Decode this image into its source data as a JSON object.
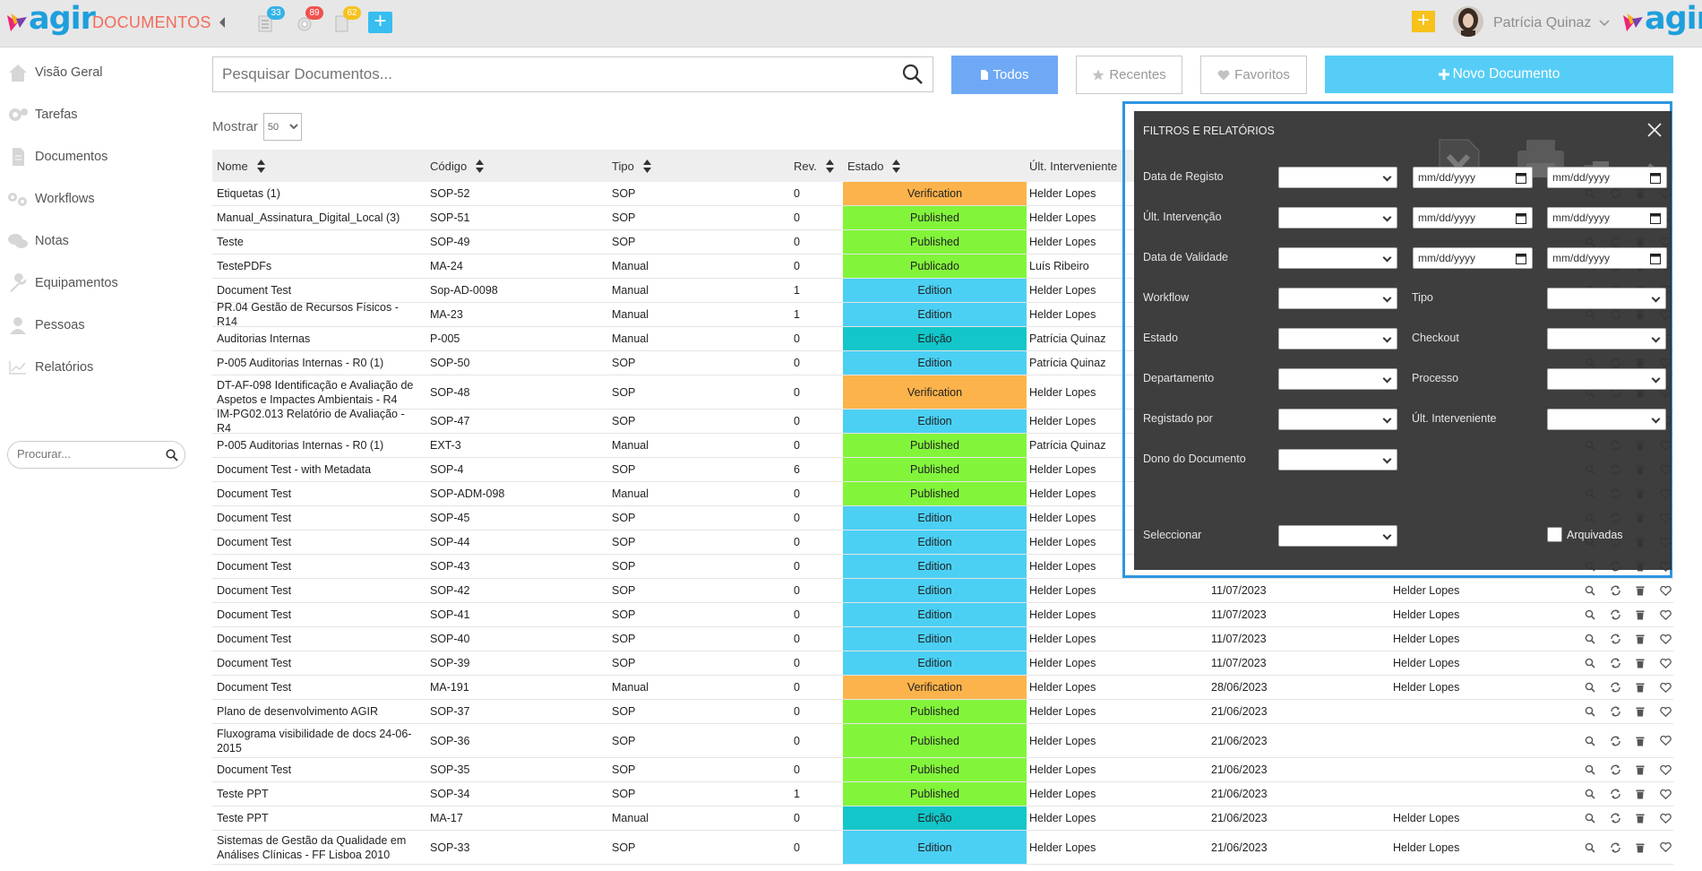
{
  "app": {
    "section_title": "DOCUMENTOS",
    "logo_text": "agir",
    "user_name": "Patrícia Quinaz"
  },
  "badges": {
    "docs": "33",
    "settings": "89",
    "files": "62"
  },
  "colors": {
    "accent": "#56cdf6",
    "verification": "#fcb34b",
    "published": "#82f53b",
    "edition": "#4bd0f4",
    "edicao": "#13c6c9",
    "publicado": "#82f53b"
  },
  "sidebar": {
    "items": [
      {
        "label": "Visão Geral",
        "icon": "home-icon"
      },
      {
        "label": "Tarefas",
        "icon": "gears-icon"
      },
      {
        "label": "Documentos",
        "icon": "document-icon"
      },
      {
        "label": "Workflows",
        "icon": "workflow-icon"
      },
      {
        "label": "Notas",
        "icon": "comments-icon"
      },
      {
        "label": "Equipamentos",
        "icon": "wrench-icon"
      },
      {
        "label": "Pessoas",
        "icon": "user-icon"
      },
      {
        "label": "Relatórios",
        "icon": "chart-icon"
      }
    ],
    "search_placeholder": "Procurar..."
  },
  "search": {
    "placeholder": "Pesquisar Documentos..."
  },
  "toolbar": {
    "all": "Todos",
    "recent": "Recentes",
    "favorites": "Favoritos",
    "new_doc": "Novo Documento"
  },
  "show": {
    "label": "Mostrar",
    "value": "50"
  },
  "columns": {
    "name": "Nome",
    "code": "Código",
    "type": "Tipo",
    "rev": "Rev.",
    "state": "Estado",
    "last": "Últ. Interveniente"
  },
  "rows": [
    {
      "name": "Etiquetas (1)",
      "code": "SOP-52",
      "type": "SOP",
      "rev": "0",
      "state": "Verification",
      "last": "Helder Lopes",
      "date": "",
      "owner": ""
    },
    {
      "name": "Manual_Assinatura_Digital_Local (3)",
      "code": "SOP-51",
      "type": "SOP",
      "rev": "0",
      "state": "Published",
      "last": "Helder Lopes",
      "date": "",
      "owner": ""
    },
    {
      "name": "Teste",
      "code": "SOP-49",
      "type": "SOP",
      "rev": "0",
      "state": "Published",
      "last": "Helder Lopes",
      "date": "",
      "owner": ""
    },
    {
      "name": "TestePDFs",
      "code": "MA-24",
      "type": "Manual",
      "rev": "0",
      "state": "Publicado",
      "last": "Luís Ribeiro",
      "date": "",
      "owner": ""
    },
    {
      "name": "Document Test",
      "code": "Sop-AD-0098",
      "type": "Manual",
      "rev": "1",
      "state": "Edition",
      "last": "Helder Lopes",
      "date": "",
      "owner": ""
    },
    {
      "name": "PR.04 Gestão de Recursos Físicos - R14",
      "code": "MA-23",
      "type": "Manual",
      "rev": "1",
      "state": "Edition",
      "last": "Helder Lopes",
      "date": "",
      "owner": ""
    },
    {
      "name": "Auditorias Internas",
      "code": "P-005",
      "type": "Manual",
      "rev": "0",
      "state": "Edição",
      "last": "Patrícia Quinaz",
      "date": "",
      "owner": ""
    },
    {
      "name": "P-005 Auditorias Internas - R0 (1)",
      "code": "SOP-50",
      "type": "SOP",
      "rev": "0",
      "state": "Edition",
      "last": "Patrícia Quinaz",
      "date": "",
      "owner": ""
    },
    {
      "name": "DT-AF-098 Identificação e Avaliação de Aspetos e Impactes Ambientais - R4",
      "code": "SOP-48",
      "type": "SOP",
      "rev": "0",
      "state": "Verification",
      "last": "Helder Lopes",
      "date": "",
      "owner": ""
    },
    {
      "name": "IM-PG02.013 Relatório de Avaliação - R4",
      "code": "SOP-47",
      "type": "SOP",
      "rev": "0",
      "state": "Edition",
      "last": "Helder Lopes",
      "date": "",
      "owner": ""
    },
    {
      "name": "P-005 Auditorias Internas - R0 (1)",
      "code": "EXT-3",
      "type": "Manual",
      "rev": "0",
      "state": "Published",
      "last": "Patrícia Quinaz",
      "date": "",
      "owner": ""
    },
    {
      "name": "Document Test - with Metadata",
      "code": "SOP-4",
      "type": "SOP",
      "rev": "6",
      "state": "Published",
      "last": "Helder Lopes",
      "date": "",
      "owner": ""
    },
    {
      "name": "Document Test",
      "code": "SOP-ADM-098",
      "type": "Manual",
      "rev": "0",
      "state": "Published",
      "last": "Helder Lopes",
      "date": "",
      "owner": ""
    },
    {
      "name": "Document Test",
      "code": "SOP-45",
      "type": "SOP",
      "rev": "0",
      "state": "Edition",
      "last": "Helder Lopes",
      "date": "",
      "owner": ""
    },
    {
      "name": "Document Test",
      "code": "SOP-44",
      "type": "SOP",
      "rev": "0",
      "state": "Edition",
      "last": "Helder Lopes",
      "date": "",
      "owner": ""
    },
    {
      "name": "Document Test",
      "code": "SOP-43",
      "type": "SOP",
      "rev": "0",
      "state": "Edition",
      "last": "Helder Lopes",
      "date": "",
      "owner": ""
    },
    {
      "name": "Document Test",
      "code": "SOP-42",
      "type": "SOP",
      "rev": "0",
      "state": "Edition",
      "last": "Helder Lopes",
      "date": "11/07/2023",
      "owner": "Helder Lopes"
    },
    {
      "name": "Document Test",
      "code": "SOP-41",
      "type": "SOP",
      "rev": "0",
      "state": "Edition",
      "last": "Helder Lopes",
      "date": "11/07/2023",
      "owner": "Helder Lopes"
    },
    {
      "name": "Document Test",
      "code": "SOP-40",
      "type": "SOP",
      "rev": "0",
      "state": "Edition",
      "last": "Helder Lopes",
      "date": "11/07/2023",
      "owner": "Helder Lopes"
    },
    {
      "name": "Document Test",
      "code": "SOP-39",
      "type": "SOP",
      "rev": "0",
      "state": "Edition",
      "last": "Helder Lopes",
      "date": "11/07/2023",
      "owner": "Helder Lopes"
    },
    {
      "name": "Document Test",
      "code": "MA-191",
      "type": "Manual",
      "rev": "0",
      "state": "Verification",
      "last": "Helder Lopes",
      "date": "28/06/2023",
      "owner": "Helder Lopes"
    },
    {
      "name": "Plano de desenvolvimento AGIR",
      "code": "SOP-37",
      "type": "SOP",
      "rev": "0",
      "state": "Published",
      "last": "Helder Lopes",
      "date": "21/06/2023",
      "owner": ""
    },
    {
      "name": "Fluxograma visibilidade de docs 24-06-2015",
      "code": "SOP-36",
      "type": "SOP",
      "rev": "0",
      "state": "Published",
      "last": "Helder Lopes",
      "date": "21/06/2023",
      "owner": ""
    },
    {
      "name": "Document Test",
      "code": "SOP-35",
      "type": "SOP",
      "rev": "0",
      "state": "Published",
      "last": "Helder Lopes",
      "date": "21/06/2023",
      "owner": ""
    },
    {
      "name": "Teste PPT",
      "code": "SOP-34",
      "type": "SOP",
      "rev": "1",
      "state": "Published",
      "last": "Helder Lopes",
      "date": "21/06/2023",
      "owner": ""
    },
    {
      "name": "Teste PPT",
      "code": "MA-17",
      "type": "Manual",
      "rev": "0",
      "state": "Edição",
      "last": "Helder Lopes",
      "date": "21/06/2023",
      "owner": "Helder Lopes"
    },
    {
      "name": "Sistemas de Gestão da Qualidade em Análises Clínicas - FF Lisboa 2010",
      "code": "SOP-33",
      "type": "SOP",
      "rev": "0",
      "state": "Edition",
      "last": "Helder Lopes",
      "date": "21/06/2023",
      "owner": "Helder Lopes"
    }
  ],
  "filters": {
    "title": "FILTROS E RELATÓRIOS",
    "date_placeholder": "mm/dd/yyyy",
    "registo": "Data de Registo",
    "intervencao": "Últ. Intervenção",
    "validade": "Data de Validade",
    "workflow": "Workflow",
    "tipo": "Tipo",
    "estado": "Estado",
    "checkout": "Checkout",
    "departamento": "Departamento",
    "processo": "Processo",
    "registado_por": "Registado por",
    "ult_interveniente": "Últ. Interveniente",
    "dono": "Dono do Documento",
    "seleccionar": "Seleccionar",
    "arquivadas": "Arquivadas"
  }
}
